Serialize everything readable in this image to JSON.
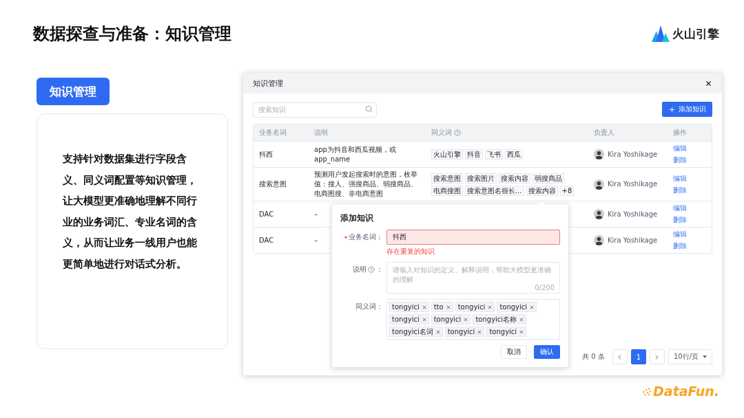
{
  "slide": {
    "title": "数据探查与准备：知识管理",
    "brand": "火山引擎",
    "footer_brand": "DataFun."
  },
  "feature": {
    "label": "知识管理",
    "description": "支持针对数据集进行字段含义、同义词配置等知识管理，让大模型更准确地理解不同行业的业务词汇、专业名词的含义，从而让业务一线用户也能更简单地进行对话式分析。"
  },
  "window": {
    "title": "知识管理"
  },
  "search": {
    "placeholder": "搜索知识"
  },
  "add_button": "添加知识",
  "table": {
    "columns": [
      {
        "label": "业务名词",
        "help": false
      },
      {
        "label": "说明",
        "help": false
      },
      {
        "label": "同义词",
        "help": true
      },
      {
        "label": "负责人",
        "help": false
      },
      {
        "label": "操作",
        "help": false
      }
    ],
    "rows": [
      {
        "term": "抖西",
        "description": "app为抖音和西瓜视频，或app_name",
        "synonyms": [
          "火山引擎",
          "抖音",
          "飞书",
          "西瓜"
        ],
        "owner": "Kira Yoshikage",
        "actions": [
          "编辑",
          "删除"
        ]
      },
      {
        "term": "搜索意图",
        "description": "预测用户发起搜索时的意图，枚举值：搜人、强搜商品、弱搜商品、电商图搜、非电商意图",
        "synonyms": [
          "搜索意图",
          "搜索图片",
          "搜索内容",
          "弱搜商品",
          "电商搜图",
          "搜索意图名很长...",
          "搜索内容"
        ],
        "more": "+8",
        "owner": "Kira Yoshikage",
        "actions": [
          "编辑",
          "删除"
        ]
      },
      {
        "term": "DAC",
        "description": "–",
        "synonyms": [],
        "owner": "Kira Yoshikage",
        "actions": [
          "编辑",
          "删除"
        ]
      },
      {
        "term": "DAC",
        "description": "–",
        "synonyms": [],
        "owner": "Kira Yoshikage",
        "actions": [
          "编辑",
          "删除"
        ]
      }
    ]
  },
  "pagination": {
    "total": "共 0 条",
    "pages": [
      {
        "label": "1",
        "selected": true
      }
    ],
    "page_size": "10行/页"
  },
  "popover": {
    "title": "添加知识",
    "name": {
      "label": "业务名词：",
      "required": true,
      "value": "抖西",
      "error": true,
      "error_message": "存在重复的知识"
    },
    "description": {
      "label": "说明",
      "suffix": "：",
      "placeholder": "请输入对知识的定义、解释说明，帮助大模型更准确的理解",
      "counter": "0/200"
    },
    "synonyms": {
      "label": "同义词：",
      "tags": [
        "tongyici",
        "tto",
        "tongyici",
        "tongyici",
        "tongyici",
        "tongyici",
        "tongyici名称",
        "tongyici名词",
        "tongyici",
        "tongyici"
      ]
    },
    "buttons": [
      {
        "label": "取消",
        "kind": "secondary"
      },
      {
        "label": "确认",
        "kind": "primary"
      }
    ]
  }
}
